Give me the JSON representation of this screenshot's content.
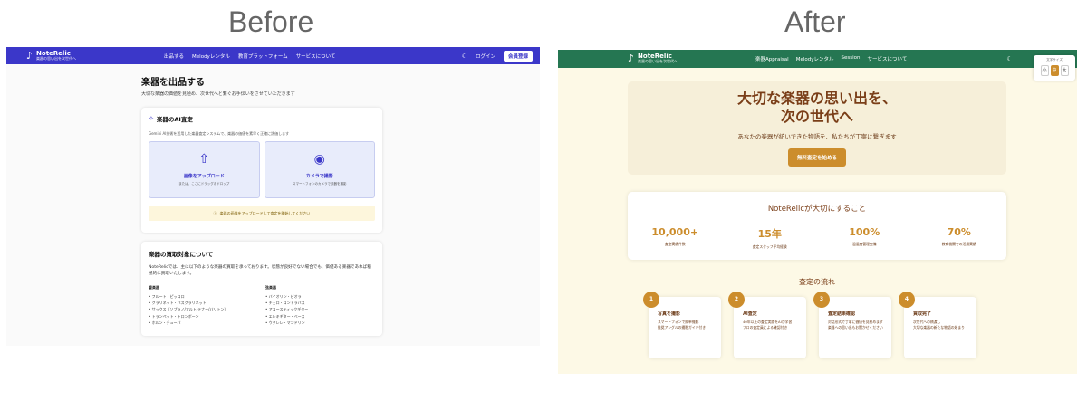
{
  "captions": {
    "before": "Before",
    "after": "After"
  },
  "before": {
    "nav": {
      "logo_name": "NoteRelic",
      "logo_tagline": "楽器の思い出を次世代へ",
      "links": [
        "出品する",
        "Melodyレンタル",
        "教育プラットフォーム",
        "サービスについて"
      ],
      "login": "ログイン",
      "register": "会員登録"
    },
    "page_title": "楽器を出品する",
    "page_subtitle": "大切な楽器の価値を見極め、次世代へと繋ぐお手伝いをさせていただきます",
    "ai_card": {
      "title": "楽器のAI査定",
      "description": "Gemini AI技術を活用した楽器査定システムで、楽器の価値を素早く正確に評価します",
      "upload_title": "画像をアップロード",
      "upload_sub": "または、ここにドラッグ＆ドロップ",
      "camera_title": "カメラで撮影",
      "camera_sub": "スマートフォンのカメラで楽器を撮影",
      "notice": "楽器の画像をアップロードして査定を開始してください"
    },
    "buy_card": {
      "title": "楽器の買取対象について",
      "text": "NoteRelicでは、主に以下のような楽器の買取を承っております。状態が良好でない場合でも、価値ある楽器であれば積極的に買取いたします。",
      "wind_title": "管楽器",
      "wind": [
        "フルート・ピッコロ",
        "クラリネット・バスクラリネット",
        "サックス（ソプラノ/アルト/テナー/バリトン）",
        "トランペット・トロンボーン",
        "ホルン・チューバ"
      ],
      "string_title": "弦楽器",
      "string": [
        "バイオリン・ビオラ",
        "チェロ・コントラバス",
        "アコースティックギター",
        "エレキギター・ベース",
        "ウクレレ・マンドリン"
      ]
    }
  },
  "after": {
    "nav": {
      "logo_name": "NoteRelic",
      "logo_tagline": "楽器の思い出を次世代へ",
      "links": [
        "楽器Appraisal",
        "Melodyレンタル",
        "Session",
        "サービスについて"
      ]
    },
    "size_control": {
      "label": "文字サイズ",
      "small": "小",
      "medium": "中",
      "large": "大"
    },
    "hero": {
      "title_line1": "大切な楽器の思い出を、",
      "title_line2": "次の世代へ",
      "subtitle": "あなたの楽器が紡いできた物語を、私たちが丁寧に繋ぎます",
      "cta": "無料査定を始める"
    },
    "values": {
      "title": "NoteRelicが大切にすること",
      "stats": [
        {
          "number": "10,000+",
          "label": "査定実績件数"
        },
        {
          "number": "15年",
          "label": "査定スタッフ平均経験"
        },
        {
          "number": "100%",
          "label": "温湿度管理完備"
        },
        {
          "number": "70%",
          "label": "教育機関での活用実績"
        }
      ]
    },
    "flow": {
      "title": "査定の流れ",
      "steps": [
        {
          "num": "1",
          "title": "写真を撮影",
          "desc": "スマートフォンで簡単撮影\n推奨アングルの撮影ガイド付き"
        },
        {
          "num": "2",
          "title": "AI査定",
          "desc": "40年以上の査定実績をAIが学習\nプロの査定員による確認付き"
        },
        {
          "num": "3",
          "title": "査定結果確認",
          "desc": "対話形式で丁寧に価値を見極めます\n楽器への思い出もお聞かせください"
        },
        {
          "num": "4",
          "title": "買取完了",
          "desc": "次世代への橋渡し\n大切な楽器の新たな物語の始まり"
        }
      ]
    }
  }
}
